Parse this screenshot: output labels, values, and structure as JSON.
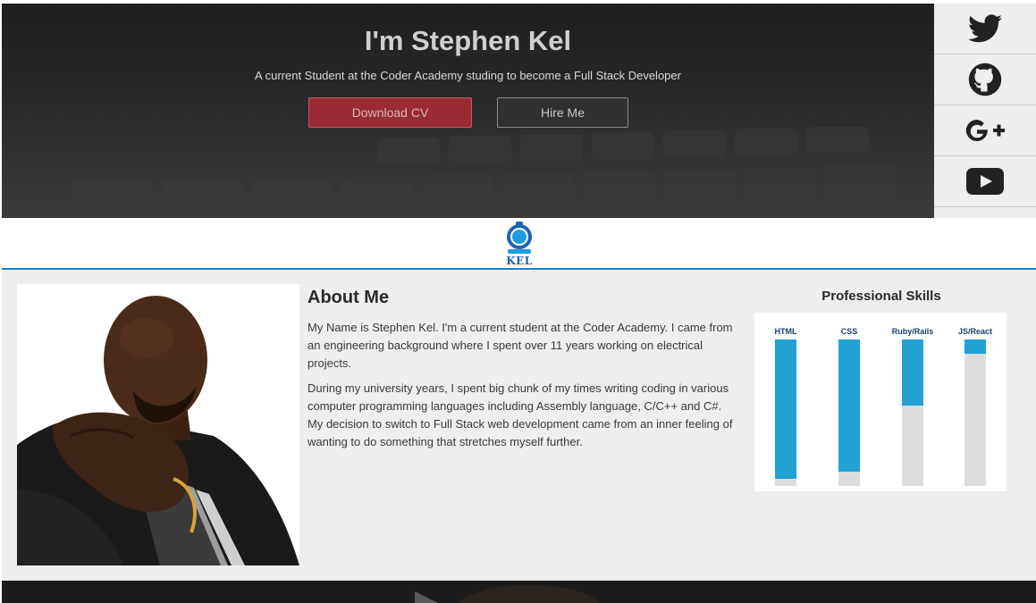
{
  "hero": {
    "title": "I'm Stephen Kel",
    "subtitle": "A current Student at the Coder Academy studing to become a Full Stack Developer",
    "download_label": "Download CV",
    "hire_label": "Hire Me"
  },
  "social": [
    "twitter-icon",
    "github-icon",
    "google-plus-icon",
    "youtube-icon"
  ],
  "logo": {
    "text": "KEL"
  },
  "about": {
    "heading": "About Me",
    "paragraph1": "My Name is Stephen Kel. I'm a current student at the Coder Academy. I came from an engineering background where I spent over 11 years working on electrical projects.",
    "paragraph2": "During my university years, I spent big chunk of my times writing coding in various computer programming languages including Assembly language, C/C++ and C#. My decision to switch to Full Stack web development came from an inner feeling of wanting to do something that stretches myself further."
  },
  "skills": {
    "title": "Professional Skills",
    "items": [
      {
        "label": "HTML",
        "level": 0.95
      },
      {
        "label": "CSS",
        "level": 0.9
      },
      {
        "label": "Ruby/Rails",
        "level": 0.45
      },
      {
        "label": "JS/React",
        "level": 0.1
      }
    ]
  },
  "colors": {
    "accent": "#22a1d3",
    "brand_blue": "#1b7fc6",
    "cv_button": "#9a2a33"
  }
}
